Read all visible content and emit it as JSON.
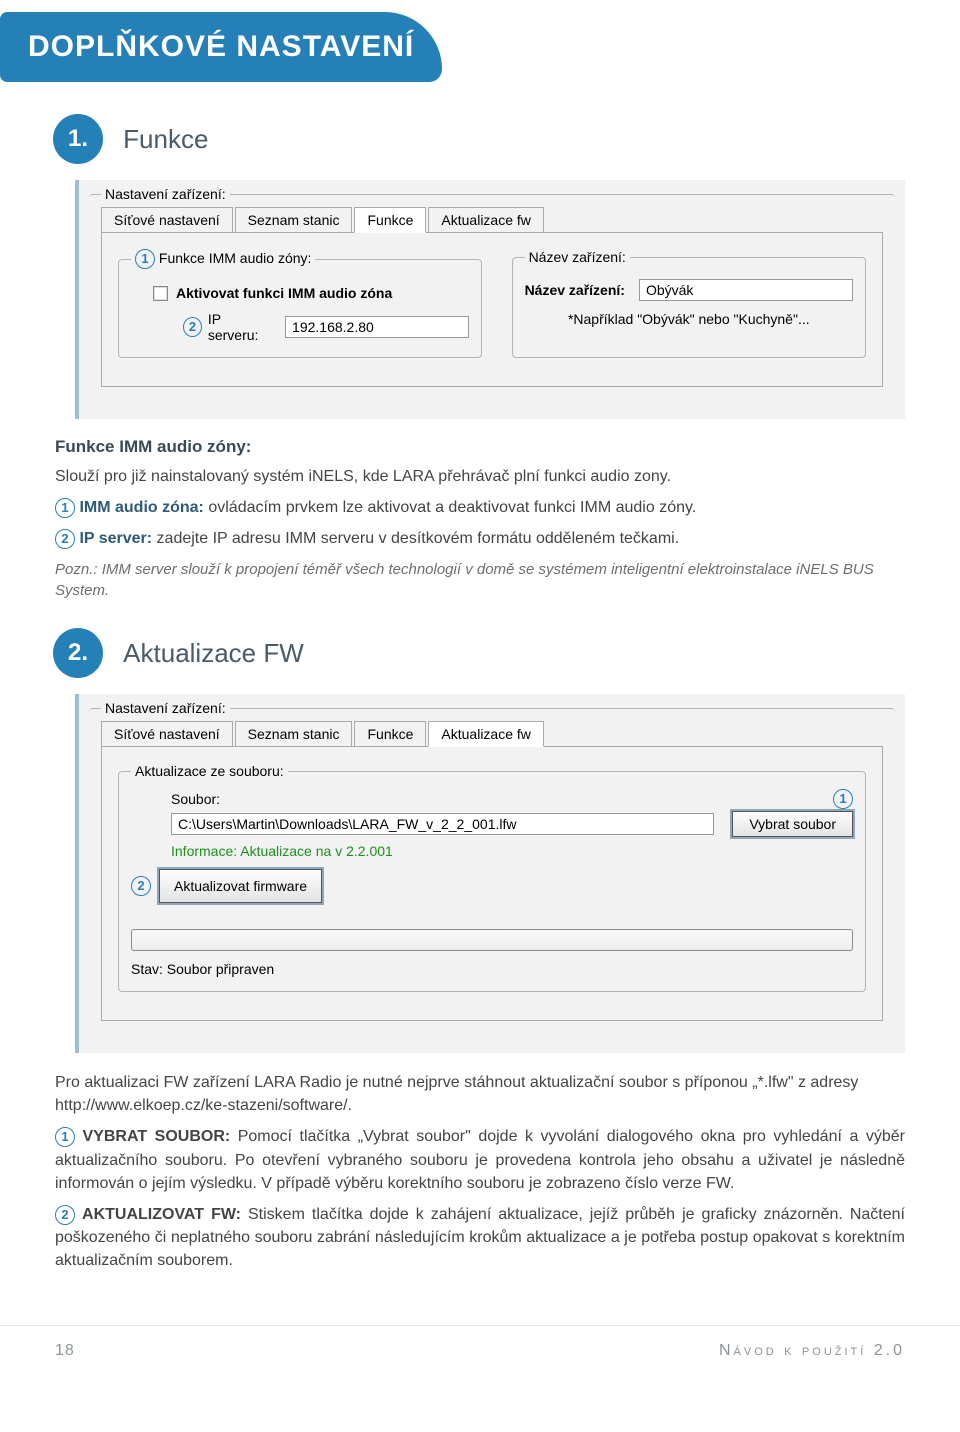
{
  "header_title": "DOPLŇKOVÉ NASTAVENÍ",
  "section1": {
    "num": "1.",
    "title": "Funkce",
    "panel_legend": "Nastavení zařízení:",
    "tabs": [
      "Síťové nastavení",
      "Seznam stanic",
      "Funkce",
      "Aktualizace fw"
    ],
    "active_tab": "Funkce",
    "group1_legend": "Funkce IMM audio zóny:",
    "checkbox_label": "Aktivovat funkci IMM audio zóna",
    "ip_label": "IP serveru:",
    "ip_value": "192.168.2.80",
    "group2_legend": "Název zařízení:",
    "name_label": "Název zařízení:",
    "name_value": "Obývák",
    "name_hint": "*Například \"Obývák\" nebo \"Kuchyně\"...",
    "text_intro_title": "Funkce IMM audio zóny:",
    "text_intro": "Slouží pro již nainstalovaný systém iNELS, kde LARA přehrávač plní funkci audio zony.",
    "bullet1_bold": "IMM audio zóna:",
    "bullet1_text": " ovládacím prvkem lze aktivovat a deaktivovat funkci IMM audio zóny.",
    "bullet2_bold": "IP server:",
    "bullet2_text": " zadejte IP adresu IMM serveru v desítkovém formátu odděleném tečkami.",
    "note_label": "Pozn.: ",
    "note_text": "IMM server slouží k propojení téměř všech technologií v domě se systémem inteligentní elektroinstalace iNELS BUS System."
  },
  "section2": {
    "num": "2.",
    "title": "Aktualizace FW",
    "panel_legend": "Nastavení zařízení:",
    "tabs": [
      "Síťové nastavení",
      "Seznam stanic",
      "Funkce",
      "Aktualizace fw"
    ],
    "active_tab": "Aktualizace fw",
    "group_legend": "Aktualizace ze souboru:",
    "file_label": "Soubor:",
    "file_value": "C:\\Users\\Martin\\Downloads\\LARA_FW_v_2_2_001.lfw",
    "btn_browse": "Vybrat soubor",
    "info_line": "Informace: Aktualizace na v 2.2.001",
    "btn_update": "Aktualizovat firmware",
    "status_label": "Stav: ",
    "status_value": "Soubor připraven",
    "para1": "Pro aktualizaci FW zařízení LARA Radio je nutné nejprve stáhnout aktualizační soubor s příponou „*.lfw\" z adresy http://www.elkoep.cz/ke-stazeni/software/.",
    "bullet1_bold": "VYBRAT SOUBOR:",
    "bullet1_text": " Pomocí tlačítka „Vybrat soubor\" dojde k vyvolání dialogového okna pro vyhledání a výběr aktualizačního souboru. Po otevření vybraného souboru je provedena kontrola jeho obsahu a uživatel je následně informován o jejím výsledku. V případě výběru korektního souboru je zobrazeno číslo verze FW.",
    "bullet2_bold": "AKTUALIZOVAT FW:",
    "bullet2_text": " Stiskem tlačítka dojde k zahájení aktualizace, jejíž průběh je graficky znázorněn. Načtení poškozeného či neplatného souboru zabrání následujícím krokům aktualizace a je potřeba postup opakovat s korektním aktualizačním souborem."
  },
  "footer": {
    "page": "18",
    "right": "Návod k použití 2.0"
  }
}
